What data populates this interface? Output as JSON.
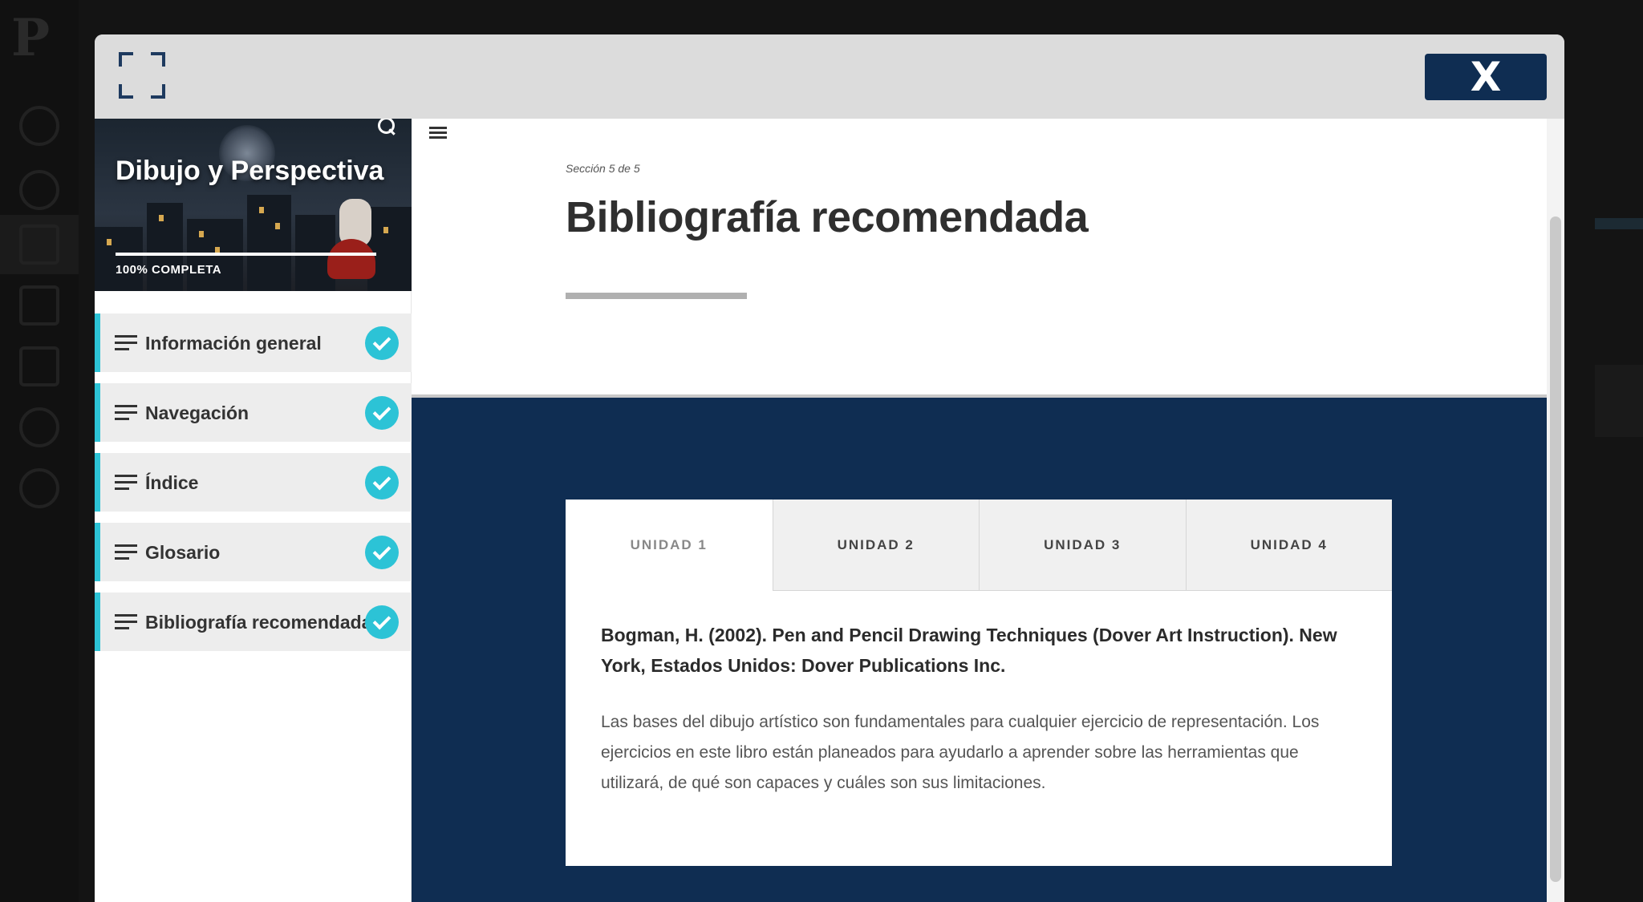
{
  "app": {
    "logo_text": "P",
    "rail_icons": [
      "profile-icon",
      "dashboard-icon",
      "courses-icon",
      "calendar-icon",
      "printer-icon",
      "logout-icon",
      "info-icon"
    ]
  },
  "modal": {
    "close_label": "X",
    "expand_icon": "fullscreen-icon"
  },
  "course": {
    "title": "Dibujo y Perspectiva",
    "progress_label": "100% COMPLETA",
    "progress_fraction": 1.0
  },
  "sidebar": {
    "items": [
      {
        "label": "Información general",
        "completed": true
      },
      {
        "label": "Navegación",
        "completed": true
      },
      {
        "label": "Índice",
        "completed": true
      },
      {
        "label": "Glosario",
        "completed": true
      },
      {
        "label": "Bibliografía recomendada",
        "completed": true
      }
    ]
  },
  "content": {
    "section_counter": "Sección 5 de 5",
    "title": "Bibliografía recomendada",
    "tabs": [
      {
        "label": "UNIDAD 1",
        "active": true
      },
      {
        "label": "UNIDAD 2",
        "active": false
      },
      {
        "label": "UNIDAD 3",
        "active": false
      },
      {
        "label": "UNIDAD 4",
        "active": false
      }
    ],
    "reference": {
      "citation": "Bogman, H. (2002). Pen and Pencil Drawing Techniques (Dover Art Instruction). New York, Estados Unidos: Dover Publications Inc.",
      "description": "Las bases del dibujo artístico son fundamentales para cualquier ejercicio de representación. Los ejercicios en este libro están planeados para ayudarlo a aprender sobre las herramientas que utilizará, de qué son capaces y cuáles son sus limitaciones."
    }
  },
  "colors": {
    "accent": "#2cc3d6",
    "navy": "#0f2d52"
  }
}
